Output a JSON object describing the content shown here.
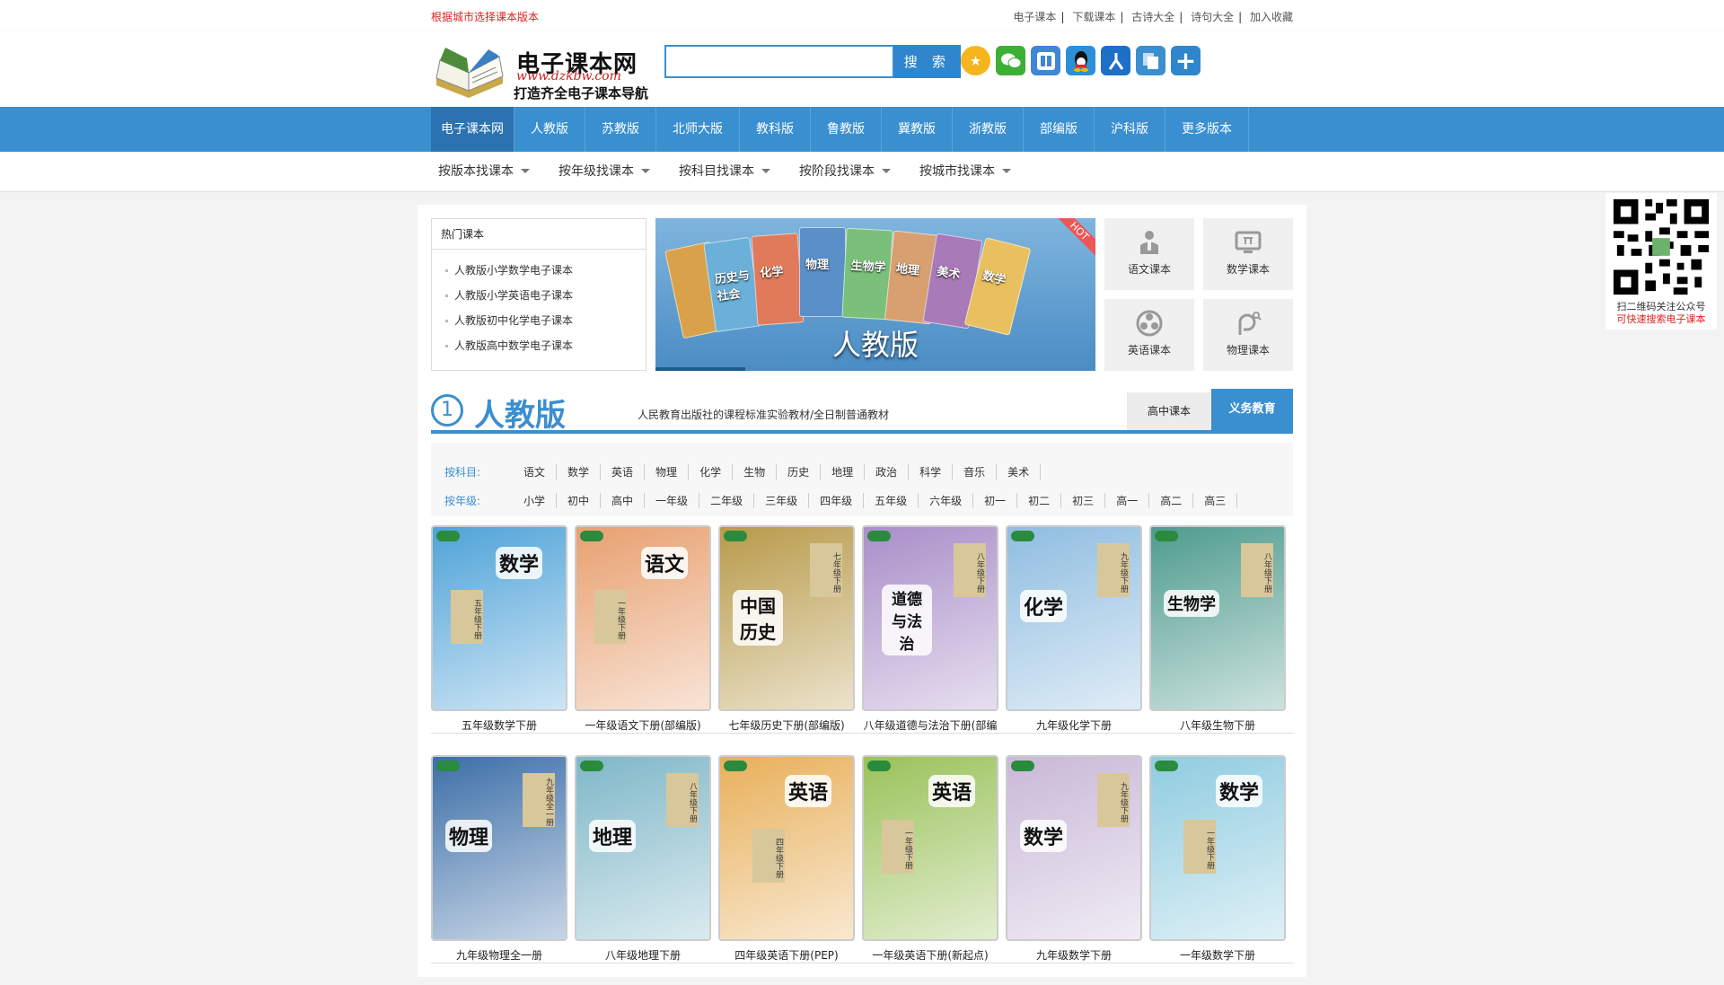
{
  "topbar": {
    "tip": "根据城市选择课本版本",
    "links": [
      "电子课本",
      "下载课本",
      "古诗大全",
      "诗句大全",
      "加入收藏"
    ]
  },
  "logo": {
    "name": "电子课本网",
    "url": "www.dzkbw.com",
    "slogan": "打造齐全电子课本导航"
  },
  "search": {
    "button": "搜 索",
    "value": ""
  },
  "social_icons": [
    "qzone-icon",
    "wechat-icon",
    "tieba-icon",
    "qq-icon",
    "renren-icon",
    "copy-icon",
    "more-share-icon"
  ],
  "nav": [
    "电子课本网",
    "人教版",
    "苏教版",
    "北师大版",
    "教科版",
    "鲁教版",
    "冀教版",
    "浙教版",
    "部编版",
    "沪科版",
    "更多版本"
  ],
  "subnav": [
    "按版本找课本",
    "按年级找课本",
    "按科目找课本",
    "按阶段找课本",
    "按城市找课本"
  ],
  "hot": {
    "title": "热门课本",
    "items": [
      "人教版小学数学电子课本",
      "人教版小学英语电子课本",
      "人教版初中化学电子课本",
      "人教版高中数学电子课本"
    ]
  },
  "banner": {
    "title": "人教版",
    "tag": "HOT",
    "books": [
      "历史与社会",
      "化学",
      "物理",
      "生物学",
      "地理",
      "美术",
      "数学"
    ]
  },
  "tiles": [
    {
      "label": "语文课本",
      "icon": "teacher-icon"
    },
    {
      "label": "数学课本",
      "icon": "monitor-icon"
    },
    {
      "label": "英语课本",
      "icon": "globe-icon"
    },
    {
      "label": "物理课本",
      "icon": "magnet-icon"
    }
  ],
  "section": {
    "num": "1",
    "title": "人教版",
    "desc": "人民教育出版社的课程标准实验教材/全日制普通教材",
    "tab1": "高中课本",
    "tab2": "义务教育"
  },
  "filters": {
    "subject_label": "按科目:",
    "subjects": [
      "语文",
      "数学",
      "英语",
      "物理",
      "化学",
      "生物",
      "历史",
      "地理",
      "政治",
      "科学",
      "音乐",
      "美术"
    ],
    "grade_label": "按年级:",
    "grades": [
      "小学",
      "初中",
      "高中",
      "一年级",
      "二年级",
      "三年级",
      "四年级",
      "五年级",
      "六年级",
      "初一",
      "初二",
      "初三",
      "高一",
      "高二",
      "高三"
    ]
  },
  "books_row1": [
    {
      "label": "五年级数学下册",
      "cover": "数学",
      "grade": "五年级下册",
      "color": "#4fa3d8"
    },
    {
      "label": "一年级语文下册(部编版)",
      "cover": "语文",
      "grade": "一年级下册",
      "color": "#e8a070"
    },
    {
      "label": "七年级历史下册(部编版)",
      "cover": "中国历史",
      "grade": "七年级下册",
      "color": "#b89a4a"
    },
    {
      "label": "八年级道德与法治下册(部编",
      "cover": "道德与法治",
      "grade": "八年级下册",
      "color": "#a98ec8"
    },
    {
      "label": "九年级化学下册",
      "cover": "化学",
      "grade": "九年级下册",
      "color": "#8fbde0"
    },
    {
      "label": "八年级生物下册",
      "cover": "生物学",
      "grade": "八年级下册",
      "color": "#4e9b8e"
    }
  ],
  "books_row2": [
    {
      "label": "九年级物理全一册",
      "cover": "物理",
      "grade": "九年级全一册",
      "color": "#3d6fa8"
    },
    {
      "label": "八年级地理下册",
      "cover": "地理",
      "grade": "八年级下册",
      "color": "#7fb7c8"
    },
    {
      "label": "四年级英语下册(PEP)",
      "cover": "英语",
      "grade": "四年级下册",
      "color": "#e8b05a"
    },
    {
      "label": "一年级英语下册(新起点)",
      "cover": "英语",
      "grade": "一年级下册",
      "color": "#9ac25a"
    },
    {
      "label": "九年级数学下册",
      "cover": "数学",
      "grade": "九年级下册",
      "color": "#c9b8d8"
    },
    {
      "label": "一年级数学下册",
      "cover": "数学",
      "grade": "一年级下册",
      "color": "#8fcce0"
    }
  ],
  "qr": {
    "line1": "扫二维码关注公众号",
    "line2": "可快速搜索电子课本"
  }
}
